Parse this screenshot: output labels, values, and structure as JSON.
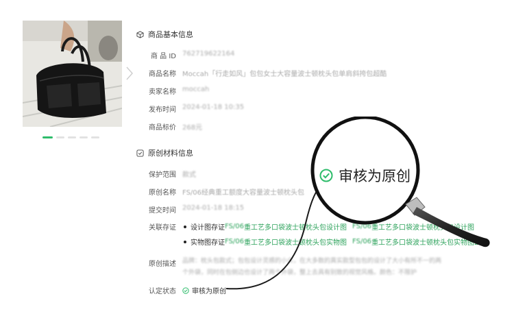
{
  "gallery": {
    "image_count": 5,
    "active_index": 0
  },
  "basic": {
    "title": "商品基本信息",
    "rows": [
      {
        "label": "商 品 ID",
        "value": "7627196221​64"
      },
      {
        "label": "商品名称",
        "value": "Moccah「行走如风」包包女士大容量波士顿枕头包单肩斜挎包超酷"
      },
      {
        "label": "卖家名称",
        "value": "moccah"
      },
      {
        "label": "发布时间",
        "value": "2024-01-18 10:35"
      },
      {
        "label": "商品标价",
        "value": "268元"
      }
    ]
  },
  "original": {
    "title": "原创材料信息",
    "rows": [
      {
        "label": "保护范围",
        "value": "款式"
      },
      {
        "label": "原创名称",
        "value": "FS/06经典重工额度大容量波士顿枕头包"
      },
      {
        "label": "提交时间",
        "value": "2024-01-18 18:15"
      }
    ],
    "evidence_label": "关联存证",
    "evidence": [
      {
        "type": "设计图存证",
        "prefix": "FS/06",
        "link": "重工艺多口袋波士顿枕头包设计图",
        "prefix2": "FS/06",
        "link2": "重工艺多口袋波士顿枕头包设计图"
      },
      {
        "type": "实物图存证",
        "prefix": "FS/06",
        "link": "重工艺多口袋波士顿枕头包实物图",
        "prefix2": "FS/06",
        "link2": "重工艺多口袋波士顿枕头包实物图2"
      }
    ],
    "desc_label": "原创描述",
    "desc_value": "品牌：枕头包款式；包包设计灵感的小众，在大多数的真实款型包包的设计了大小有所不一的两个外袋，同时在包侧边也设计了两个外袋，整上去具有别致的视觉风格。颜色：不限护",
    "status_label": "认定状态",
    "status_value": "审核为原创"
  },
  "magnifier": {
    "text": "审核为原创"
  },
  "colors": {
    "accent": "#2ebc6b",
    "link": "#2ea35c"
  }
}
